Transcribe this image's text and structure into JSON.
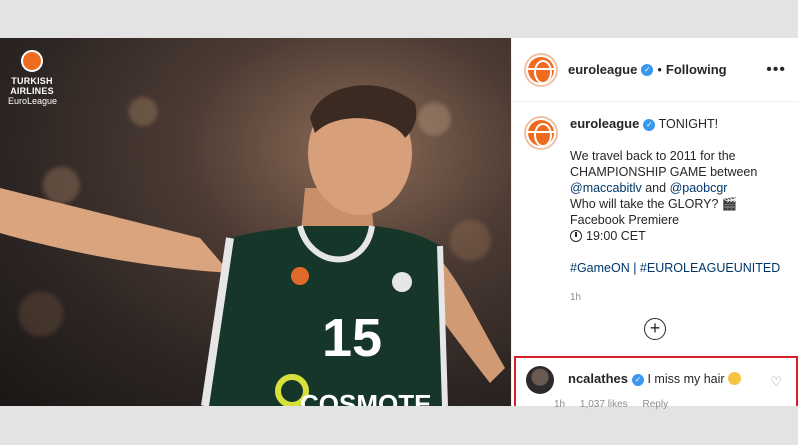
{
  "brand": {
    "line1": "TURKISH",
    "line2": "AIRLINES",
    "line3": "EuroLeague"
  },
  "player": {
    "jersey_number": "15",
    "sponsor": "COSMOTE"
  },
  "post": {
    "username": "euroleague",
    "dot": "•",
    "follow_status": "Following",
    "more_label": "•••",
    "caption": {
      "username": "euroleague",
      "lead": "TONIGHT!",
      "line1": "We travel back to 2011 for the",
      "line2": "CHAMPIONSHIP GAME between",
      "mention1": "@maccabitlv",
      "and": "and",
      "mention2": "@paobcgr",
      "line4": "Who will take the GLORY? 🎬",
      "line5": "Facebook Premiere",
      "time_label": "19:00 CET",
      "hashtags": "#GameON | #EUROLEAGUEUNITED",
      "age": "1h"
    },
    "add_comment_icon": "plus-circle-icon"
  },
  "comment": {
    "username": "ncalathes",
    "text": "I miss my hair",
    "age": "1h",
    "likes": "1,037 likes",
    "reply": "Reply"
  },
  "colors": {
    "accent_red": "#d61f26",
    "verified_blue": "#3897f0",
    "brand_orange": "#ef6b1f",
    "jersey_green": "#17362a"
  }
}
